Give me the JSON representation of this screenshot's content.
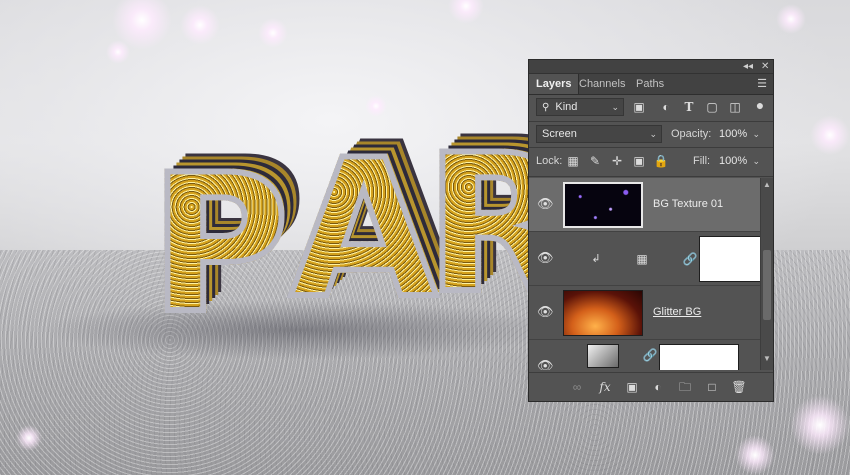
{
  "panel": {
    "topstrip": {
      "collapse_icon": "double-chevron-left-icon",
      "close_icon": "close-icon"
    },
    "tabs": [
      {
        "label": "Layers",
        "active": true
      },
      {
        "label": "Channels",
        "active": false
      },
      {
        "label": "Paths",
        "active": false
      }
    ],
    "menu_icon": "panel-menu-icon",
    "filter": {
      "kind_label": "Kind",
      "search_icon": "search-icon",
      "filter_icons": [
        "image-filter-icon",
        "adjustment-filter-icon",
        "type-filter-icon",
        "shape-filter-icon",
        "smart-object-filter-icon",
        "filter-toggle-icon"
      ]
    },
    "blend": {
      "mode": "Screen",
      "opacity_label": "Opacity:",
      "opacity_value": "100%"
    },
    "lock": {
      "label": "Lock:",
      "icons": [
        "lock-transparent-pixels-icon",
        "lock-image-pixels-icon",
        "lock-position-icon",
        "lock-artboard-icon",
        "lock-all-icon"
      ],
      "fill_label": "Fill:",
      "fill_value": "100%"
    },
    "layers": [
      {
        "name": "BG Texture 01",
        "selected": true,
        "visible": true,
        "type": "image"
      },
      {
        "name": "",
        "selected": false,
        "visible": true,
        "type": "adjustment-clipped"
      },
      {
        "name": "Glitter BG",
        "selected": false,
        "visible": true,
        "type": "image"
      },
      {
        "name": "",
        "selected": false,
        "visible": true,
        "type": "gradient-with-mask"
      }
    ],
    "footer_icons": [
      "link-layers-icon",
      "fx-icon",
      "add-mask-icon",
      "adjustment-layer-icon",
      "new-group-icon",
      "new-layer-icon",
      "delete-icon"
    ],
    "footer_fx_label": "fx"
  },
  "scene": {
    "letters": [
      "P",
      "A",
      "R"
    ]
  }
}
